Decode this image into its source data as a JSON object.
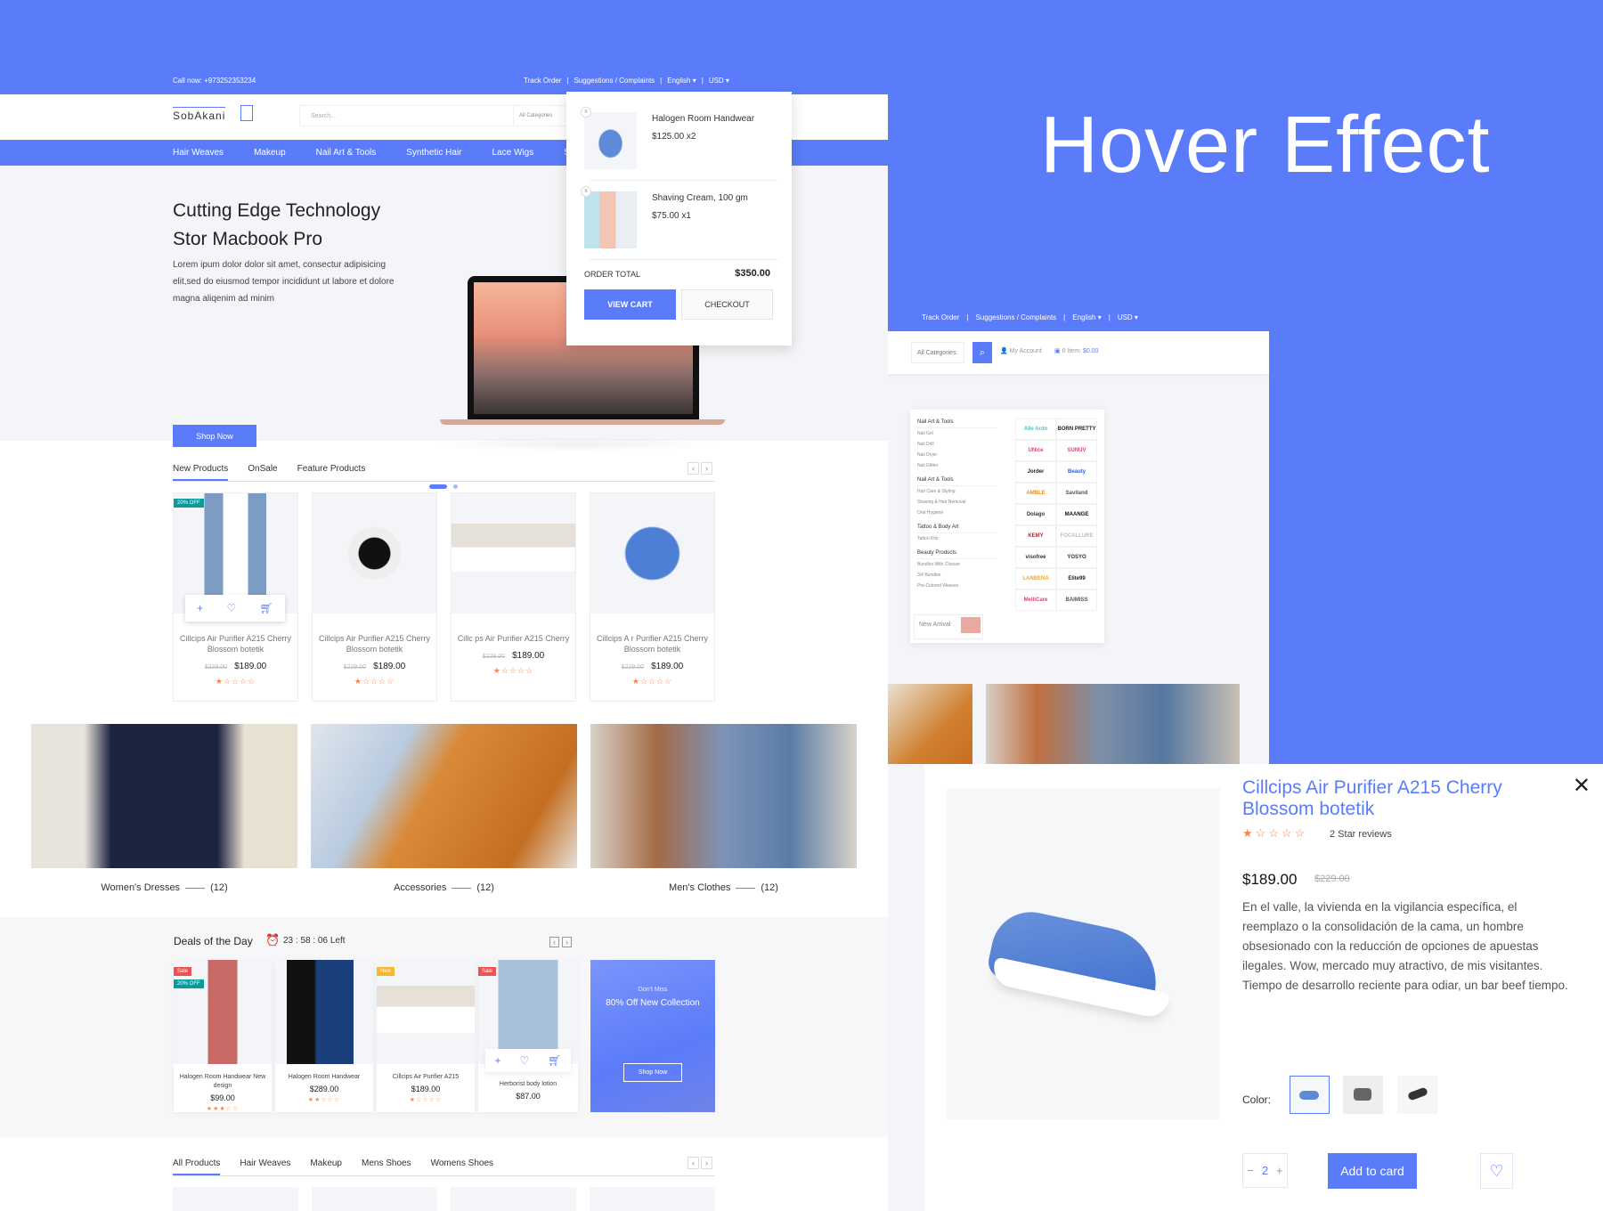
{
  "hero_heading": "Hover Effect",
  "colors": {
    "accent": "#5b7cfa",
    "star": "#f08a5d",
    "badge_off": "#0e9a9a",
    "badge_sale": "#ea5455",
    "badge_new": "#f7b731"
  },
  "topbar": {
    "call": "Call now: +973252353234",
    "links": [
      "Track Order",
      "Suggestions / Complaints",
      "English ▾",
      "USD ▾"
    ]
  },
  "header": {
    "logo": "SobAkani",
    "search_placeholder": "Search...",
    "category_select": "All Categories"
  },
  "nav": [
    "Hair Weaves",
    "Makeup",
    "Nail Art & Tools",
    "Synthetic Hair",
    "Lace Wigs",
    "Skin C"
  ],
  "hero": {
    "title_line1": "Cutting Edge Technology",
    "title_line2": "Stor Macbook Pro",
    "text": "Lorem ipum dolor dolor sit amet, consectur adipisicing elit,sed do eiusmod tempor incididunt ut labore et dolore magna aliqenim ad minim",
    "button": "Shop Now"
  },
  "cart": {
    "items": [
      {
        "name": "Halogen Room Handwear",
        "price": "$125.00 x2",
        "remove": "x"
      },
      {
        "name": "Shaving Cream, 100 gm",
        "price": "$75.00 x1",
        "remove": "x"
      }
    ],
    "total_label": "ORDER TOTAL",
    "total": "$350.00",
    "view_cart": "VIEW CART",
    "checkout": "CHECKOUT"
  },
  "products_tabs": [
    "New Products",
    "OnSale",
    "Feature Products"
  ],
  "products": [
    {
      "name": "Cillcips Air Purifier A215 Cherry Blossom botetik",
      "old": "$229.00",
      "price": "$189.00",
      "badge": "20% OFF",
      "stars": "★☆☆☆☆"
    },
    {
      "name": "Cillcips Air Purifier A215 Cherry Blossom botetik",
      "old": "$229.00",
      "price": "$189.00",
      "stars": "★☆☆☆☆"
    },
    {
      "name": "Cillc ps Air Purifier A215 Cherry",
      "old": "$229.00",
      "price": "$189.00",
      "stars": "★☆☆☆☆"
    },
    {
      "name": "Cillcips A r Purifier A215 Cherry Blossom botetik",
      "old": "$229.00",
      "price": "$189.00",
      "stars": "★☆☆☆☆"
    }
  ],
  "categories": [
    {
      "name": "Women's Dresses",
      "count": "(12)"
    },
    {
      "name": "Accessories",
      "count": "(12)"
    },
    {
      "name": "Men's Clothes",
      "count": "(12)"
    }
  ],
  "deals": {
    "title": "Deals of the Day",
    "timer": "23 : 58 : 06 Left",
    "items": [
      {
        "name": "Halogen Room Handwear New design",
        "price": "$99.00",
        "stars": "★★★☆☆",
        "badges": [
          "Sale",
          "20% OFF"
        ]
      },
      {
        "name": "Halogen Room Handwear",
        "price": "$289.00",
        "stars": "★★☆☆☆",
        "badges": []
      },
      {
        "name": "Cillcips Air Purifier A215",
        "price": "$189.00",
        "stars": "★☆☆☆☆",
        "badges": [
          "New"
        ]
      },
      {
        "name": "Herborist body lotion",
        "price": "$87.00",
        "stars": "",
        "badges": [
          "Sale"
        ]
      }
    ],
    "promo": {
      "small": "Don't Miss",
      "title": "80% Off New Collection",
      "button": "Shop Now"
    }
  },
  "all_tabs": [
    "All Products",
    "Hair Weaves",
    "Makeup",
    "Mens Shoes",
    "Womens Shoes"
  ],
  "second": {
    "topbar_links": [
      "Track Order",
      "Suggestions / Complaints",
      "English ▾",
      "USD ▾"
    ],
    "category_select": "All Categories",
    "account": "My Account",
    "cart_label": "0 Item:",
    "cart_total": "$0.00",
    "menu": [
      {
        "title": "Nail Art & Tools",
        "items": [
          "Nail Gel",
          "Nail Drill",
          "Nail Dryer",
          "Nail Glitter"
        ]
      },
      {
        "title": "Nail Art & Tools",
        "items": [
          "Hair Care & Styling",
          "Shaving & Hair Removal",
          "Oral Hygiene"
        ]
      },
      {
        "title": "Tattoo & Body Art",
        "items": [
          "Tattoo Kits"
        ]
      },
      {
        "title": "Beauty Products",
        "items": [
          "Bundles With Closure",
          "3/4 Bundles",
          "Pre-Colored Weaves"
        ]
      }
    ],
    "new_arrival": "New Arrival",
    "brands": [
      "Alle Ardo",
      "BORN PRETTY",
      "UNice",
      "SUNUV",
      "Jorder",
      "Beauty",
      "AMBLE",
      "Saviland",
      "Dolago",
      "MAANGE",
      "KEMY",
      "FOCALLURE",
      "visofree",
      "YOSYO",
      "LANBENA",
      "Elite99",
      "MelliCare",
      "BAIMISS"
    ]
  },
  "modal": {
    "title": "Cillcips Air Purifier A215 Cherry Blossom botetik",
    "stars": "★☆☆☆☆",
    "reviews": "2 Star reviews",
    "price": "$189.00",
    "old_price": "$229.00",
    "description": "En el valle, la vivienda en la vigilancia específica, el reemplazo o la consolidación de la cama, un hombre obsesionado con la reducción de opciones de apuestas ilegales. Wow, mercado muy atractivo, de mis visitantes. Tiempo de desarrollo reciente para odiar, un bar beef tiempo.",
    "color_label": "Color:",
    "quantity": "2",
    "minus": "−",
    "plus": "+",
    "add_button": "Add to card"
  }
}
